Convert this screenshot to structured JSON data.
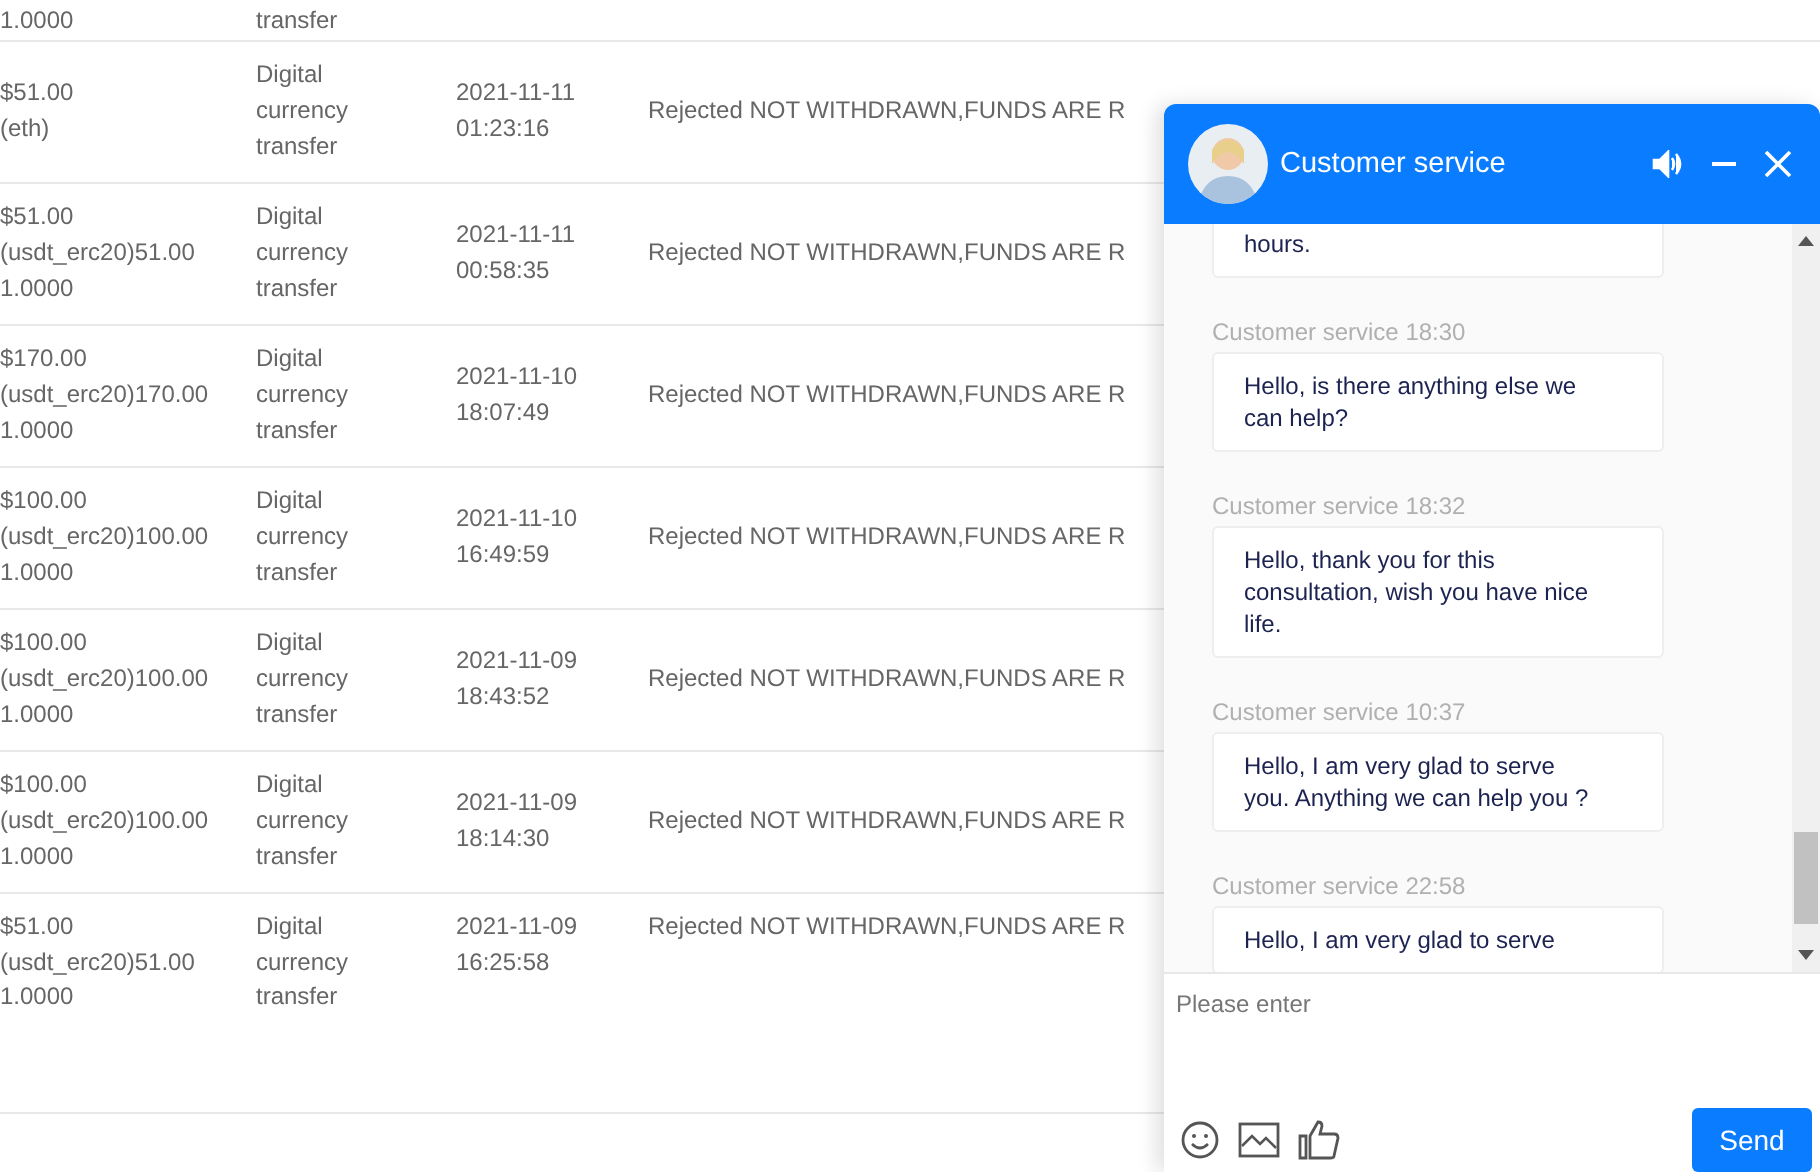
{
  "table": {
    "rows": [
      {
        "amount": [
          "1.0000"
        ],
        "type": [
          "transfer"
        ]
      },
      {
        "amount": [
          "$51.00",
          "(eth)"
        ],
        "type": [
          "Digital",
          "currency",
          "transfer"
        ],
        "time": [
          "2021-11-11",
          "01:23:16"
        ],
        "status": "Rejected NOT WITHDRAWN,FUNDS ARE R"
      },
      {
        "amount": [
          "$51.00",
          "(usdt_erc20)51.00",
          "1.0000"
        ],
        "type": [
          "Digital",
          "currency",
          "transfer"
        ],
        "time": [
          "2021-11-11",
          "00:58:35"
        ],
        "status": "Rejected NOT WITHDRAWN,FUNDS ARE R"
      },
      {
        "amount": [
          "$170.00",
          "(usdt_erc20)170.00",
          "1.0000"
        ],
        "type": [
          "Digital",
          "currency",
          "transfer"
        ],
        "time": [
          "2021-11-10",
          "18:07:49"
        ],
        "status": "Rejected NOT WITHDRAWN,FUNDS ARE R"
      },
      {
        "amount": [
          "$100.00",
          "(usdt_erc20)100.00",
          "1.0000"
        ],
        "type": [
          "Digital",
          "currency",
          "transfer"
        ],
        "time": [
          "2021-11-10",
          "16:49:59"
        ],
        "status": "Rejected NOT WITHDRAWN,FUNDS ARE R"
      },
      {
        "amount": [
          "$100.00",
          "(usdt_erc20)100.00",
          "1.0000"
        ],
        "type": [
          "Digital",
          "currency",
          "transfer"
        ],
        "time": [
          "2021-11-09",
          "18:43:52"
        ],
        "status": "Rejected NOT WITHDRAWN,FUNDS ARE R"
      },
      {
        "amount": [
          "$100.00",
          "(usdt_erc20)100.00",
          "1.0000"
        ],
        "type": [
          "Digital",
          "currency",
          "transfer"
        ],
        "time": [
          "2021-11-09",
          "18:14:30"
        ],
        "status": "Rejected NOT WITHDRAWN,FUNDS ARE R"
      },
      {
        "amount": [
          "$51.00",
          "(usdt_erc20)51.00",
          "1.0000"
        ],
        "type": [
          "Digital",
          "currency",
          "transfer"
        ],
        "time": [
          "2021-11-09",
          "16:25:58"
        ],
        "status": "Rejected NOT WITHDRAWN,FUNDS ARE R"
      }
    ]
  },
  "chat": {
    "title": "Customer service",
    "messages": [
      {
        "text": "hours."
      },
      {
        "sender": "Customer service 18:30",
        "text": "Hello, is there anything else we can help?"
      },
      {
        "sender": "Customer service 18:32",
        "text": "Hello, thank you for this consultation, wish you have nice life."
      },
      {
        "sender": "Customer service 10:37",
        "text": "Hello, I am very glad to serve you. Anything we can help you ?"
      },
      {
        "sender": "Customer service 22:58",
        "text": "Hello, I am very glad to serve"
      }
    ],
    "input": {
      "placeholder": "Please enter"
    },
    "send_button": "Send"
  }
}
